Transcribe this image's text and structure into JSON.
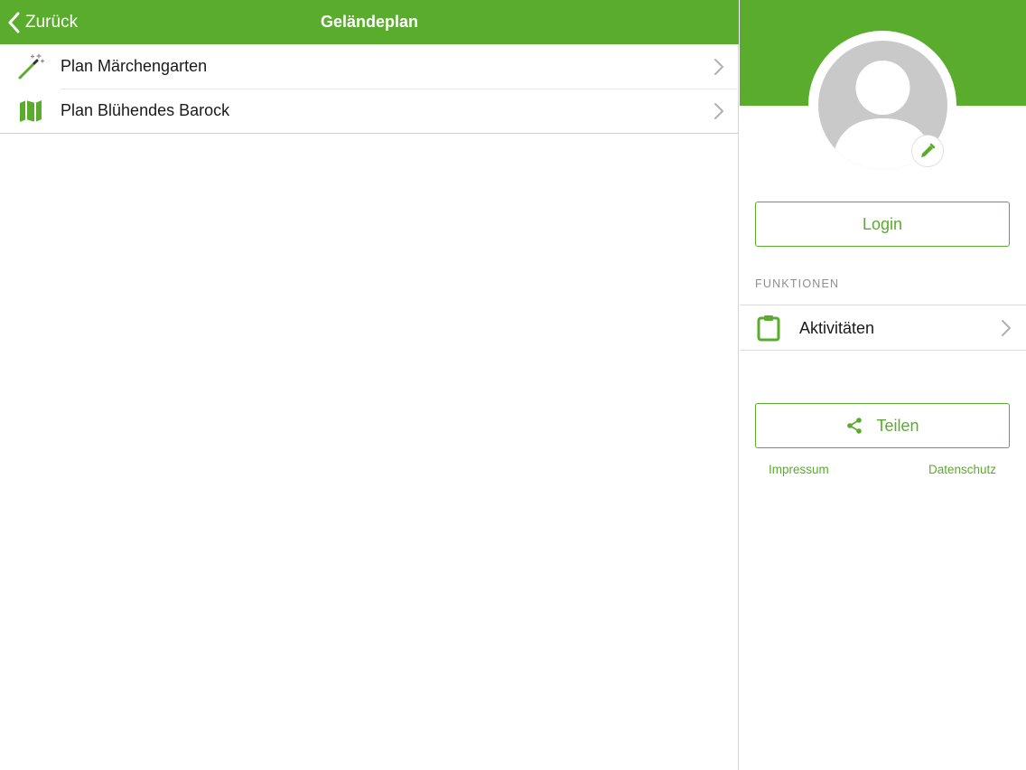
{
  "colors": {
    "accent": "#5aac2d",
    "avatar_placeholder": "#c9c9c9",
    "section_header": "#8e8e8e",
    "chevron": "#b0b0b0"
  },
  "nav": {
    "back_label": "Zurück",
    "title": "Geländeplan"
  },
  "plans": [
    {
      "label": "Plan Märchengarten",
      "icon": "magic-wand-icon"
    },
    {
      "label": "Plan Blühendes Barock",
      "icon": "map-icon"
    }
  ],
  "sidebar": {
    "login_label": "Login",
    "section_title": "FUNKTIONEN",
    "functions": [
      {
        "label": "Aktivitäten",
        "icon": "clipboard-icon"
      }
    ],
    "share_label": "Teilen",
    "links": {
      "impressum": "Impressum",
      "datenschutz": "Datenschutz"
    }
  }
}
